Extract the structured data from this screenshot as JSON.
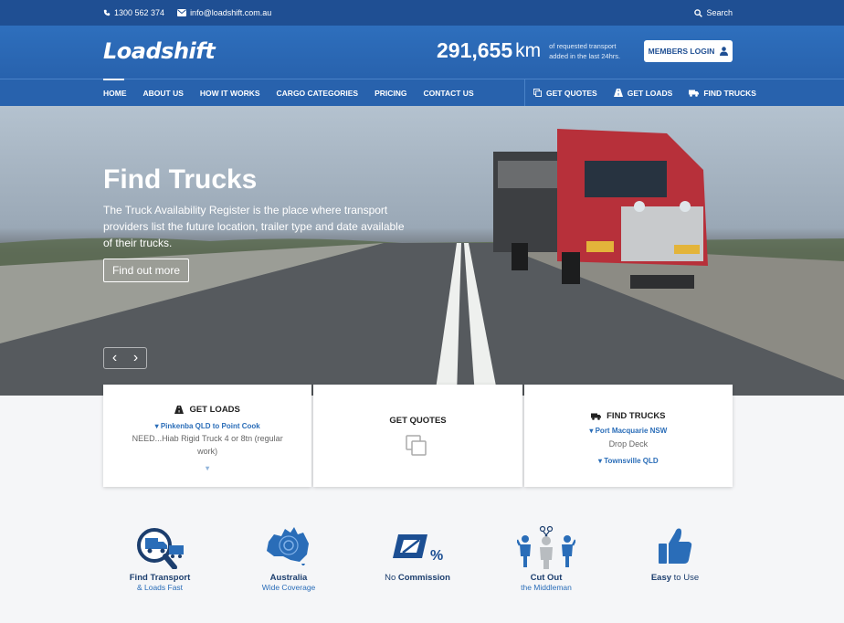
{
  "topbar": {
    "phone": "1300 562 374",
    "email": "info@loadshift.com.au",
    "search_label": "Search"
  },
  "header": {
    "logo_text": "Loadshift",
    "stat_number": "291,655",
    "stat_unit": "km",
    "stat_desc": "of requested transport added in the last 24hrs.",
    "members_login": "MEMBERS LOGIN"
  },
  "nav": {
    "items": [
      {
        "label": "HOME"
      },
      {
        "label": "ABOUT US"
      },
      {
        "label": "HOW IT WORKS"
      },
      {
        "label": "CARGO CATEGORIES"
      },
      {
        "label": "PRICING"
      },
      {
        "label": "CONTACT US"
      }
    ],
    "actions": [
      {
        "label": "GET QUOTES",
        "icon": "copy-icon"
      },
      {
        "label": "GET LOADS",
        "icon": "road-icon"
      },
      {
        "label": "FIND TRUCKS",
        "icon": "truck-icon"
      }
    ]
  },
  "hero": {
    "title": "Find Trucks",
    "text": "The Truck Availability Register is the place where transport providers list the future location, trailer type and date available of their trucks.",
    "button": "Find out more"
  },
  "cards": {
    "loads": {
      "title": "GET LOADS",
      "route": "Pinkenba QLD to Point Cook",
      "detail": "NEED...Hiab Rigid Truck 4 or 8tn (regular work)"
    },
    "quotes": {
      "title": "GET QUOTES"
    },
    "trucks": {
      "title": "FIND TRUCKS",
      "route": "Port Macquarie NSW",
      "detail": "Drop Deck",
      "route2": "Townsville QLD"
    }
  },
  "features": [
    {
      "bold": "Find Transport",
      "sub": "& Loads Fast",
      "icon": "search-truck-icon"
    },
    {
      "bold": "Australia",
      "sub": "Wide Coverage",
      "icon": "australia-map-icon"
    },
    {
      "pre": "No ",
      "bold": "Commission",
      "icon": "zero-percent-icon"
    },
    {
      "bold": "Cut Out",
      "sub": "the Middleman",
      "icon": "middleman-icon"
    },
    {
      "bold": "Easy",
      "post": " to Use",
      "icon": "thumbs-up-icon"
    }
  ],
  "colors": {
    "brand_dark": "#1f4f93",
    "brand": "#2862ad",
    "accent_text": "#2a6db8"
  }
}
